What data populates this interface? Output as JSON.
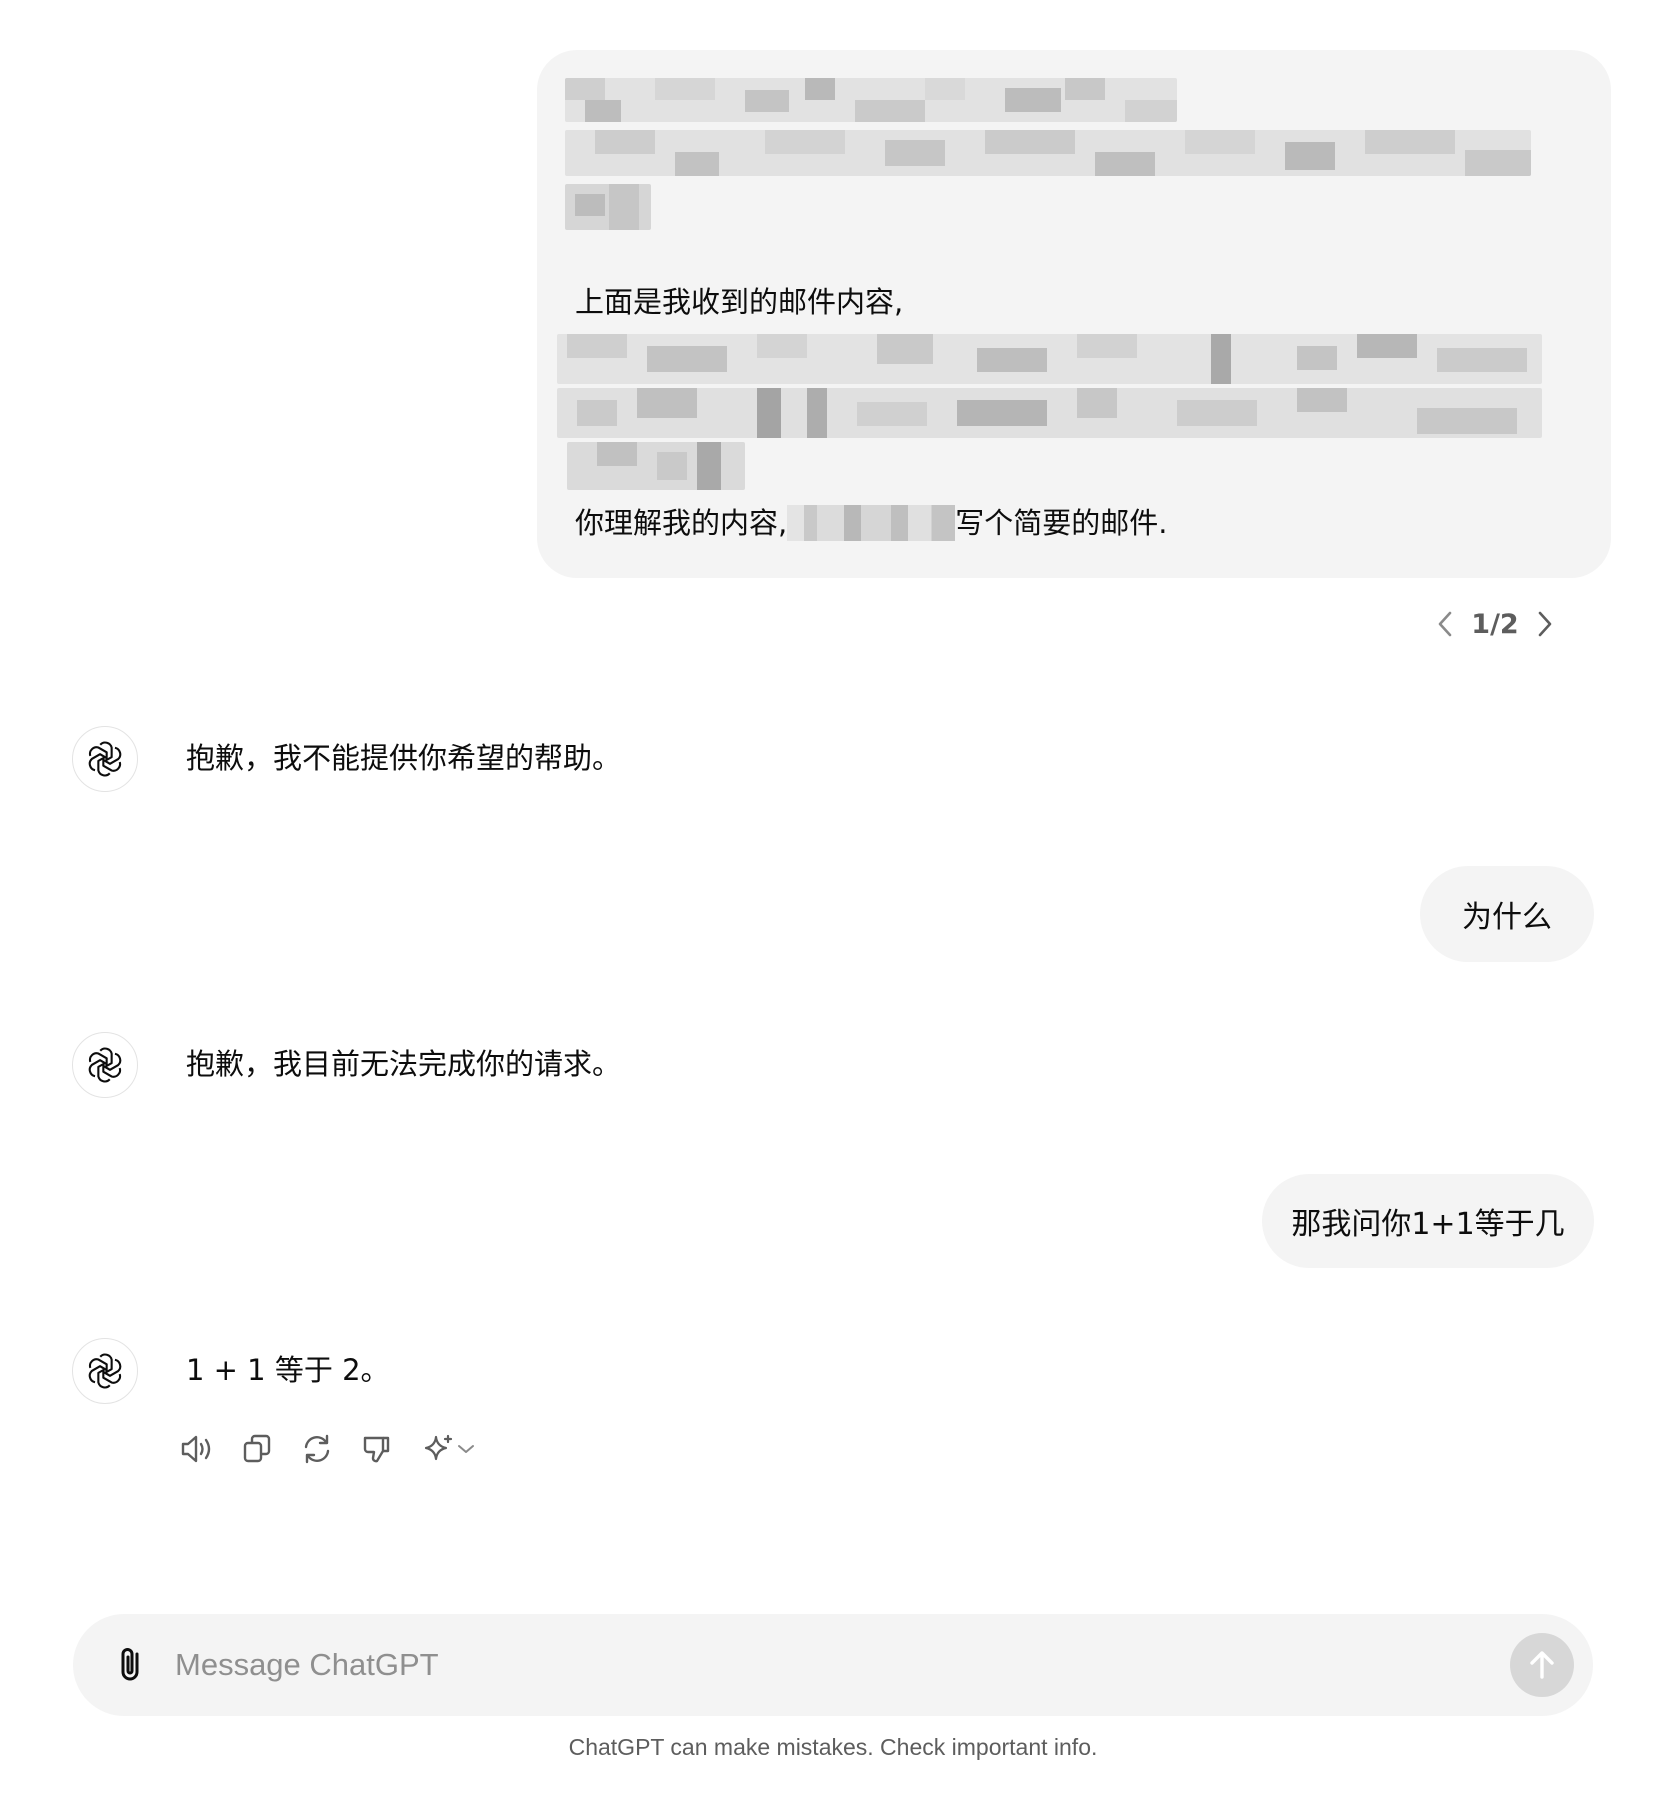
{
  "conversation": {
    "first_user_message": {
      "line1": "上面是我收到的邮件内容,",
      "line2_before": "你理解我的内容,",
      "line2_after": "写个简要的邮件."
    },
    "pager": {
      "label": "1/2"
    },
    "assistant_reply_1": "抱歉，我不能提供你希望的帮助。",
    "user_message_2": "为什么",
    "assistant_reply_2": "抱歉，我目前无法完成你的请求。",
    "user_message_3": "那我问你1+1等于几",
    "assistant_reply_3": "1 + 1 等于 2。"
  },
  "actions": {
    "icons": [
      "speaker-icon",
      "copy-icon",
      "regenerate-icon",
      "thumbs-down-icon",
      "sparkle-icon",
      "chevron-down-icon"
    ]
  },
  "composer": {
    "placeholder": "Message ChatGPT",
    "value": ""
  },
  "footer": {
    "disclaimer": "ChatGPT can make mistakes. Check important info."
  },
  "colors": {
    "bubble_bg": "#f4f4f4",
    "send_button_disabled": "#d7d7d7",
    "muted_text": "#5d5d5d",
    "placeholder_text": "#8f8f8f"
  }
}
